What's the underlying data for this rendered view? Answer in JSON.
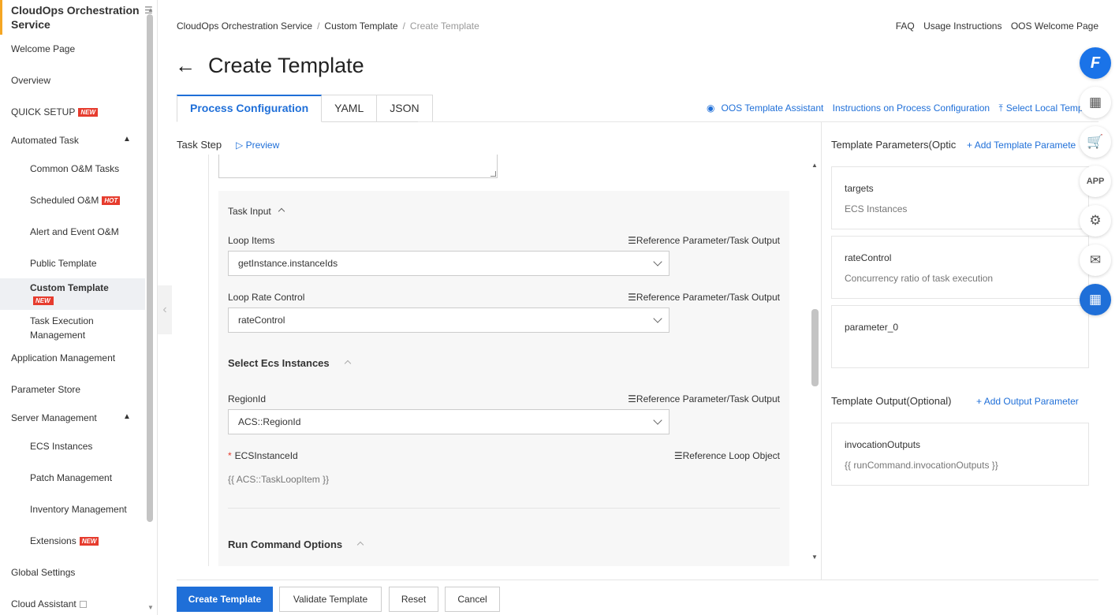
{
  "sidebar": {
    "title": "CloudOps Orchestration Service",
    "items": {
      "welcome": "Welcome Page",
      "overview": "Overview",
      "quick_setup": "QUICK SETUP",
      "automated_task": "Automated Task",
      "common_om": "Common O&M Tasks",
      "scheduled_om": "Scheduled O&M",
      "alert_om": "Alert and Event O&M",
      "public_template": "Public Template",
      "custom_template": "Custom Template",
      "task_execution": "Task Execution Management",
      "application_management": "Application Management",
      "parameter_store": "Parameter Store",
      "server_management": "Server Management",
      "ecs_instances": "ECS Instances",
      "patch_management": "Patch Management",
      "inventory_management": "Inventory Management",
      "extensions": "Extensions",
      "global_settings": "Global Settings",
      "cloud_assistant": "Cloud Assistant"
    },
    "badges": {
      "new": "NEW",
      "hot": "HOT"
    }
  },
  "header": {
    "breadcrumb": [
      "CloudOps Orchestration Service",
      "Custom Template",
      "Create Template"
    ],
    "links": [
      "FAQ",
      "Usage Instructions",
      "OOS Welcome Page"
    ],
    "title": "Create Template"
  },
  "tabs": [
    "Process Configuration",
    "YAML",
    "JSON"
  ],
  "tab_links": {
    "assistant": "OOS Template Assistant",
    "instructions": "Instructions on Process Configuration",
    "select_local": "Select Local Temp"
  },
  "task_step": {
    "label": "Task Step",
    "preview": "Preview",
    "task_input": "Task Input",
    "loop_items_label": "Loop Items",
    "loop_items_value": "getInstance.instanceIds",
    "loop_rate_label": "Loop Rate Control",
    "loop_rate_value": "rateControl",
    "reference_param": "Reference Parameter/Task Output",
    "select_ecs": "Select Ecs Instances",
    "region_label": "RegionId",
    "region_value": "ACS::RegionId",
    "ecs_instance_label": "ECSInstanceId",
    "reference_loop": "Reference Loop Object",
    "ecs_instance_value": "{{ ACS::TaskLoopItem }}",
    "run_command": "Run Command Options"
  },
  "right_panel": {
    "params_title": "Template Parameters(Optic",
    "add_param": "Add Template Paramete",
    "params": [
      {
        "name": "targets",
        "desc": "ECS Instances"
      },
      {
        "name": "rateControl",
        "desc": "Concurrency ratio of task execution"
      },
      {
        "name": "parameter_0",
        "desc": ""
      }
    ],
    "output_title": "Template Output(Optional)",
    "add_output": "Add Output Parameter",
    "outputs": [
      {
        "name": "invocationOutputs",
        "desc": "{{ runCommand.invocationOutputs }}"
      }
    ]
  },
  "floating": {
    "logo": "F",
    "icons": [
      "qr-code-icon",
      "cart-icon",
      "app-icon",
      "gear-icon",
      "chat-icon",
      "apps-icon"
    ]
  },
  "footer": {
    "create": "Create Template",
    "validate": "Validate Template",
    "reset": "Reset",
    "cancel": "Cancel"
  },
  "colors": {
    "accent": "#1f6fd8",
    "badge": "#e63c2e",
    "sidebar_accent": "#f5a623"
  }
}
